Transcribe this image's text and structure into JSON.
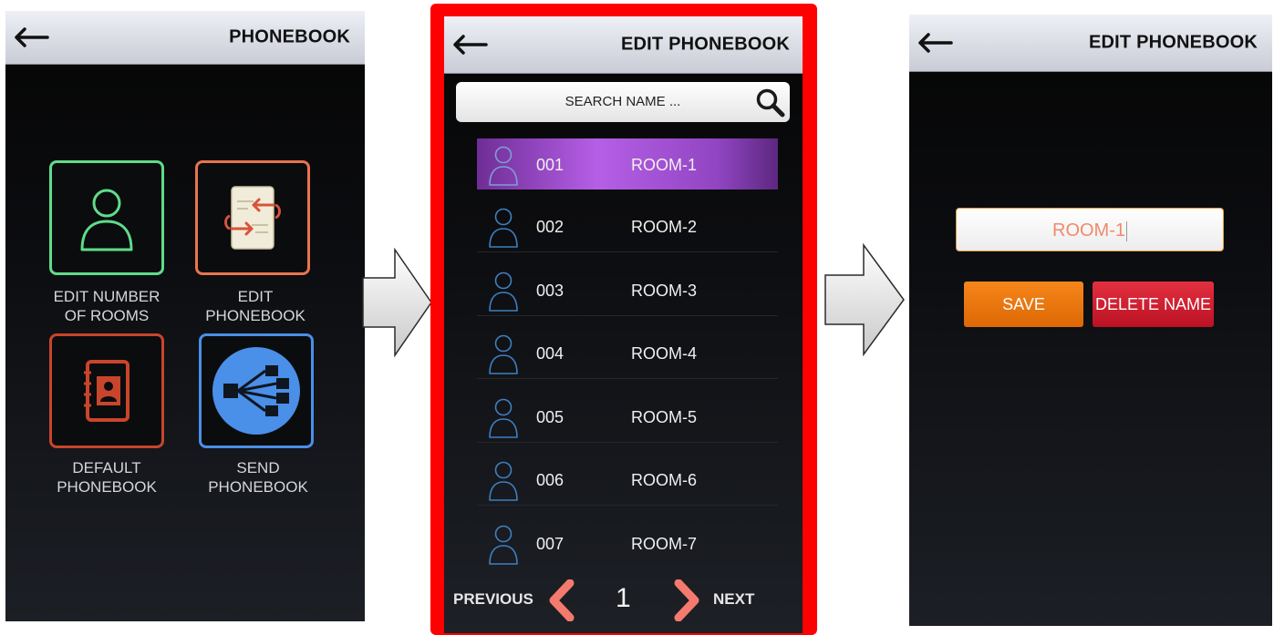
{
  "screen1": {
    "title": "PHONEBOOK",
    "tiles": [
      {
        "label_line1": "EDIT NUMBER",
        "label_line2": "OF ROOMS",
        "icon": "person-icon",
        "color": "#5fdc8a"
      },
      {
        "label_line1": "EDIT",
        "label_line2": "PHONEBOOK",
        "icon": "edit-document-icon",
        "color": "#e9744f"
      },
      {
        "label_line1": "DEFAULT",
        "label_line2": "PHONEBOOK",
        "icon": "address-book-icon",
        "color": "#c8452c"
      },
      {
        "label_line1": "SEND",
        "label_line2": "PHONEBOOK",
        "icon": "share-network-icon",
        "color": "#4a8fe8"
      }
    ]
  },
  "screen2": {
    "title": "EDIT PHONEBOOK",
    "search_placeholder": "SEARCH NAME ...",
    "rooms": [
      {
        "number": "001",
        "name": "ROOM-1",
        "selected": true
      },
      {
        "number": "002",
        "name": "ROOM-2",
        "selected": false
      },
      {
        "number": "003",
        "name": "ROOM-3",
        "selected": false
      },
      {
        "number": "004",
        "name": "ROOM-4",
        "selected": false
      },
      {
        "number": "005",
        "name": "ROOM-5",
        "selected": false
      },
      {
        "number": "006",
        "name": "ROOM-6",
        "selected": false
      },
      {
        "number": "007",
        "name": "ROOM-7",
        "selected": false
      }
    ],
    "pager": {
      "previous_label": "PREVIOUS",
      "page": "1",
      "next_label": "NEXT"
    },
    "highlight_color": "#ff0000"
  },
  "screen3": {
    "title": "EDIT PHONEBOOK",
    "name_value": "ROOM-1",
    "save_label": "SAVE",
    "delete_label": "DELETE NAME",
    "save_color": "#f07b10",
    "delete_color": "#d8232f"
  }
}
